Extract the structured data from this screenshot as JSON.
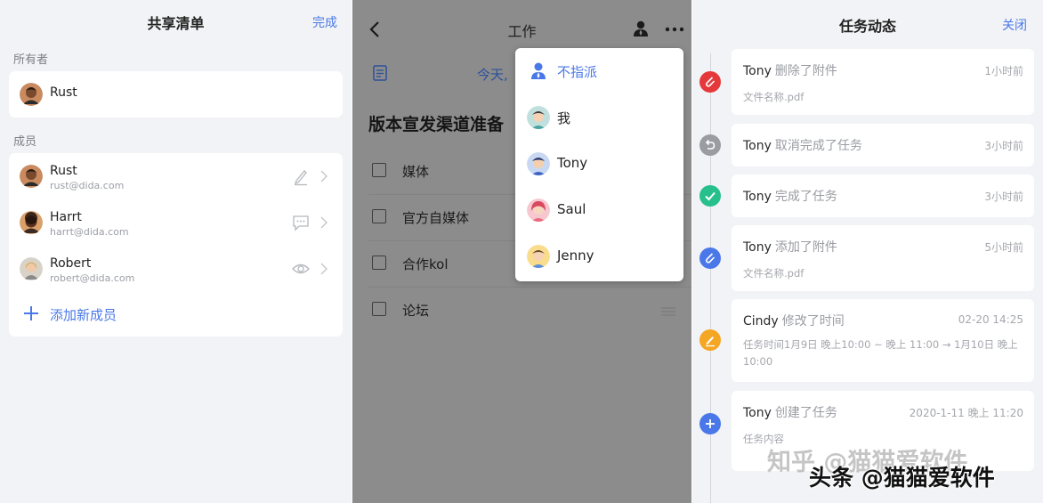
{
  "share_list": {
    "title": "共享清单",
    "done_label": "完成",
    "owner_section": "所有者",
    "owner": {
      "name": "Rust"
    },
    "member_section": "成员",
    "members": [
      {
        "name": "Rust",
        "email": "rust@dida.com",
        "permission_icon": "pencil-icon"
      },
      {
        "name": "Harrt",
        "email": "harrt@dida.com",
        "permission_icon": "comment-icon"
      },
      {
        "name": "Robert",
        "email": "robert@dida.com",
        "permission_icon": "eye-icon"
      }
    ],
    "add_member_label": "添加新成员"
  },
  "task_view": {
    "title": "工作",
    "date_label": "今天,",
    "task_title": "版本宣发渠道准备",
    "subtasks": [
      "媒体",
      "官方自媒体",
      "合作kol",
      "论坛"
    ],
    "assign_menu": [
      "不指派",
      "我",
      "Tony",
      "Saul",
      "Jenny"
    ]
  },
  "activity": {
    "title": "任务动态",
    "close_label": "关闭",
    "items": [
      {
        "user": "Tony",
        "action": "删除了附件",
        "time": "1小时前",
        "detail": "文件名称.pdf",
        "icon": "attachment-icon",
        "color": "#e5383b"
      },
      {
        "user": "Tony",
        "action": "取消完成了任务",
        "time": "3小时前",
        "detail": "",
        "icon": "undo-icon",
        "color": "#9a9ca2"
      },
      {
        "user": "Tony",
        "action": "完成了任务",
        "time": "3小时前",
        "detail": "",
        "icon": "check-icon",
        "color": "#27c08c"
      },
      {
        "user": "Tony",
        "action": "添加了附件",
        "time": "5小时前",
        "detail": "文件名称.pdf",
        "icon": "attachment-icon",
        "color": "#4a78e8"
      },
      {
        "user": "Cindy",
        "action": "修改了时间",
        "time": "02-20 14:25",
        "detail": "任务时间1月9日 晚上10:00 ~ 晚上 11:00 → 1月10日 晚上10:00",
        "icon": "pencil-icon",
        "color": "#f5a623"
      },
      {
        "user": "Tony",
        "action": "创建了任务",
        "time": "2020-1-11 晚上 11:20",
        "detail": "任务内容",
        "icon": "plus-icon",
        "color": "#4a78e8"
      }
    ]
  },
  "watermarks": {
    "faded": "知乎 @猫猫爱软件",
    "main": "头条 @猫猫爱软件"
  }
}
